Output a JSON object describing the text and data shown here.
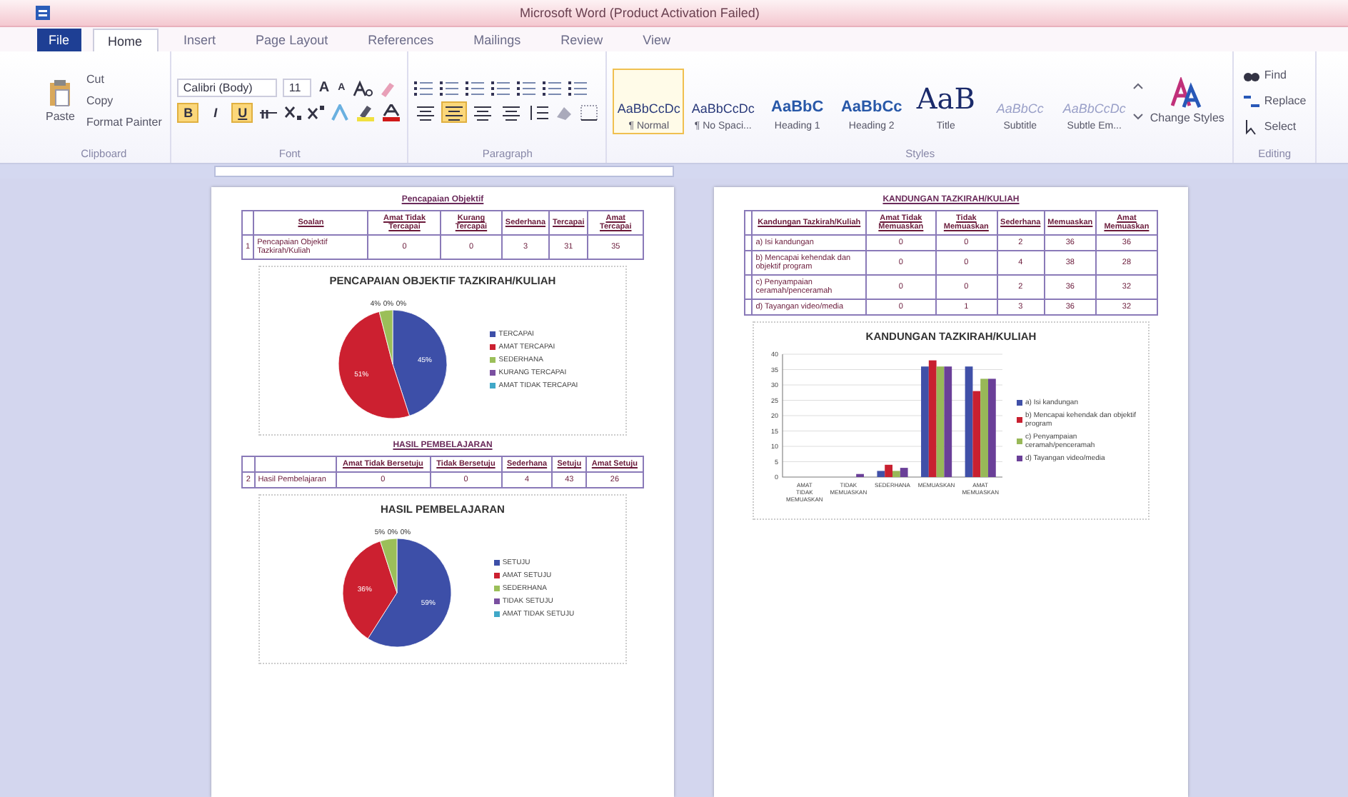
{
  "window": {
    "title": "Microsoft Word (Product Activation Failed)"
  },
  "tabs": [
    {
      "label": "File",
      "kind": "file",
      "selected": false
    },
    {
      "label": "Home",
      "kind": "tab",
      "selected": true
    },
    {
      "label": "Insert",
      "kind": "tab",
      "selected": false
    },
    {
      "label": "Page Layout",
      "kind": "tab",
      "selected": false
    },
    {
      "label": "References",
      "kind": "tab",
      "selected": false
    },
    {
      "label": "Mailings",
      "kind": "tab",
      "selected": false
    },
    {
      "label": "Review",
      "kind": "tab",
      "selected": false
    },
    {
      "label": "View",
      "kind": "tab",
      "selected": false
    }
  ],
  "ribbon_groups": [
    {
      "label": "Clipboard",
      "kind": "clipboard",
      "paste": "Paste",
      "items": [
        "Cut",
        "Copy",
        "Format Painter"
      ]
    },
    {
      "label": "Font",
      "kind": "font",
      "font": "Calibri (Body)",
      "size": "11",
      "size_buttons": [
        "A",
        "A"
      ],
      "toggles": [
        {
          "label": "B",
          "on": true
        },
        {
          "label": "I",
          "on": false
        },
        {
          "label": "U",
          "on": true
        }
      ]
    },
    {
      "label": "Paragraph",
      "kind": "paragraph",
      "alignments": [
        {
          "on": false
        },
        {
          "on": true
        },
        {
          "on": false
        },
        {
          "on": false
        }
      ]
    },
    {
      "label": "Styles",
      "kind": "styles",
      "change": "Change Styles",
      "styles": [
        {
          "sample": "AaBbCcDc",
          "name": "¶ Normal",
          "kind": "body",
          "selected": true
        },
        {
          "sample": "AaBbCcDc",
          "name": "¶ No Spaci...",
          "kind": "body",
          "selected": false
        },
        {
          "sample": "AaBbC",
          "name": "Heading 1",
          "kind": "heading",
          "selected": false
        },
        {
          "sample": "AaBbCc",
          "name": "Heading 2",
          "kind": "heading",
          "selected": false
        },
        {
          "sample": "AaB",
          "name": "Title",
          "kind": "title",
          "selected": false
        },
        {
          "sample": "AaBbCc",
          "name": "Subtitle",
          "kind": "faint",
          "selected": false
        },
        {
          "sample": "AaBbCcDc",
          "name": "Subtle Em...",
          "kind": "faint",
          "selected": false
        }
      ]
    },
    {
      "label": "Editing",
      "kind": "editing",
      "items": [
        "Find",
        "Replace",
        "Select"
      ]
    }
  ],
  "pages": [
    {
      "blocks": [
        {
          "kind": "heading",
          "text": "Pencapaian Objektif"
        },
        {
          "kind": "table",
          "columns": [
            "",
            "Soalan",
            "Amat Tidak Tercapai",
            "Kurang Tercapai",
            "Sederhana",
            "Tercapai",
            "Amat Tercapai"
          ],
          "rows": [
            [
              "1",
              "Pencapaian Objektif Tazkirah/Kuliah",
              "0",
              "0",
              "3",
              "31",
              "35"
            ]
          ]
        },
        {
          "kind": "chart",
          "chart_data": {
            "type": "pie",
            "title": "PENCAPAIAN OBJEKTIF TAZKIRAH/KULIAH",
            "legend": true,
            "data_labels": true,
            "categories": [
              "TERCAPAI",
              "AMAT TERCAPAI",
              "SEDERHANA",
              "KURANG TERCAPAI",
              "AMAT TIDAK TERCAPAI"
            ],
            "values": [
              45,
              51,
              4,
              0,
              0
            ],
            "value_labels": [
              "45%",
              "51%",
              "4%",
              "0%",
              "0%"
            ],
            "colors": [
              "#3d4fa8",
              "#cc2030",
              "#9bbf59",
              "#7a4fa0",
              "#40a8c8"
            ]
          }
        },
        {
          "kind": "heading",
          "text": "HASIL PEMBELAJARAN"
        },
        {
          "kind": "table",
          "columns": [
            "",
            "",
            "Amat Tidak Bersetuju",
            "Tidak Bersetuju",
            "Sederhana",
            "Setuju",
            "Amat Setuju"
          ],
          "rows": [
            [
              "2",
              "Hasil Pembelajaran",
              "0",
              "0",
              "4",
              "43",
              "26"
            ]
          ]
        },
        {
          "kind": "chart",
          "chart_data": {
            "type": "pie",
            "title": "HASIL PEMBELAJARAN",
            "legend": true,
            "data_labels": true,
            "categories": [
              "SETUJU",
              "AMAT SETUJU",
              "SEDERHANA",
              "TIDAK SETUJU",
              "AMAT TIDAK SETUJU"
            ],
            "values": [
              59,
              36,
              5,
              0,
              0
            ],
            "value_labels": [
              "59%",
              "36%",
              "5%",
              "0%",
              "0%"
            ],
            "colors": [
              "#3d4fa8",
              "#cc2030",
              "#9bbf59",
              "#7a4fa0",
              "#40a8c8"
            ]
          }
        }
      ]
    },
    {
      "blocks": [
        {
          "kind": "heading",
          "text": "KANDUNGAN TAZKIRAH/KULIAH"
        },
        {
          "kind": "table",
          "columns": [
            "",
            "Kandungan Tazkirah/Kuliah",
            "Amat Tidak Memuaskan",
            "Tidak Memuaskan",
            "Sederhana",
            "Memuaskan",
            "Amat Memuaskan"
          ],
          "rows": [
            [
              "",
              "a) Isi kandungan",
              "0",
              "0",
              "2",
              "36",
              "36"
            ],
            [
              "",
              "b) Mencapai kehendak dan objektif program",
              "0",
              "0",
              "4",
              "38",
              "28"
            ],
            [
              "",
              "c) Penyampaian ceramah/penceramah",
              "0",
              "0",
              "2",
              "36",
              "32"
            ],
            [
              "",
              "d) Tayangan video/media",
              "0",
              "1",
              "3",
              "36",
              "32"
            ]
          ]
        },
        {
          "kind": "chart",
          "chart_data": {
            "type": "bar",
            "title": "KANDUNGAN TAZKIRAH/KULIAH",
            "categories": [
              "AMAT TIDAK MEMUASKAN",
              "TIDAK MEMUASKAN",
              "SEDERHANA",
              "MEMUASKAN",
              "AMAT MEMUASKAN"
            ],
            "ylim": [
              0,
              40
            ],
            "grid": true,
            "legend": true,
            "yticks": [
              0,
              5,
              10,
              15,
              20,
              25,
              30,
              35,
              40
            ],
            "series": [
              {
                "name": "a) Isi kandungan",
                "color": "#4050a8",
                "values": [
                  0,
                  0,
                  2,
                  36,
                  36
                ]
              },
              {
                "name": "b) Mencapai kehendak dan objektif program",
                "color": "#c82030",
                "values": [
                  0,
                  0,
                  4,
                  38,
                  28
                ]
              },
              {
                "name": "c) Penyampaian ceramah/penceramah",
                "color": "#98b858",
                "values": [
                  0,
                  0,
                  2,
                  36,
                  32
                ]
              },
              {
                "name": "d) Tayangan video/media",
                "color": "#6a3f98",
                "values": [
                  0,
                  1,
                  3,
                  36,
                  32
                ]
              }
            ]
          }
        }
      ]
    }
  ]
}
